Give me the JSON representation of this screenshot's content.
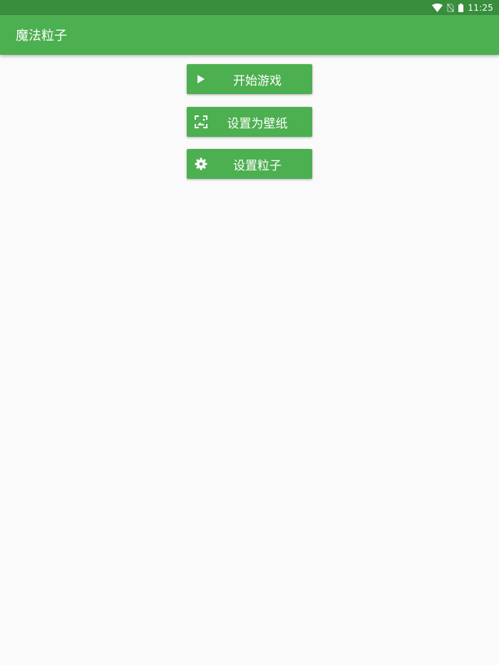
{
  "status_bar": {
    "time": "11:25",
    "icons": [
      "wifi-icon",
      "no-sim-icon",
      "battery-icon"
    ]
  },
  "app_bar": {
    "title": "魔法粒子"
  },
  "buttons": [
    {
      "label": "开始游戏",
      "icon": "play-icon"
    },
    {
      "label": "设置为壁纸",
      "icon": "wallpaper-icon"
    },
    {
      "label": "设置粒子",
      "icon": "gear-icon"
    }
  ],
  "colors": {
    "status_bar": "#388e3c",
    "primary": "#4caf50",
    "background": "#fafafa",
    "on_primary": "#ffffff"
  }
}
